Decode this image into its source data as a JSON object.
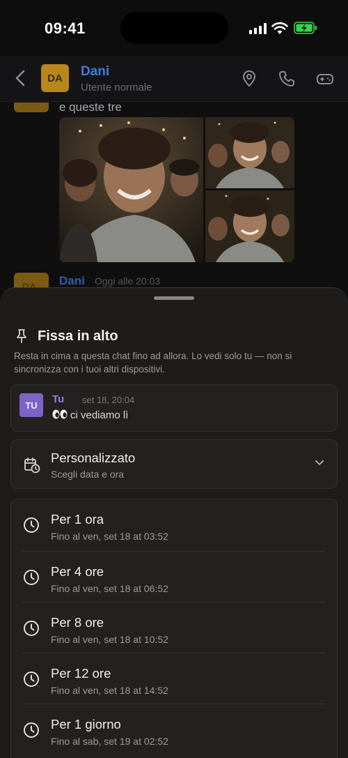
{
  "status_bar": {
    "time": "09:41"
  },
  "chat_header": {
    "avatar_initials": "DA",
    "contact_name": "Dani",
    "contact_subtitle": "Utente normale",
    "icons": [
      "back-arrow-icon",
      "location-pin-icon",
      "phone-icon",
      "gamepad-icon"
    ]
  },
  "chat": {
    "message_text": "e queste tre",
    "next_author_initials": "DA",
    "next_author_name": "Dani",
    "next_author_time": "Oggi alle 20:03"
  },
  "sheet": {
    "title": "Fissa in alto",
    "description": "Resta in cima a questa chat fino ad allora. Lo vedi solo tu — non si sincronizza con i tuoi altri dispositivi.",
    "pinned_message": {
      "avatar_initials": "TU",
      "author": "Tu",
      "time": "set 18, 20:04",
      "text": "ci vediamo lì"
    },
    "custom": {
      "title": "Personalizzato",
      "subtitle": "Scegli data e ora"
    },
    "options": [
      {
        "title": "Per 1 ora",
        "subtitle": "Fino al ven, set 18 at 03:52"
      },
      {
        "title": "Per 4 ore",
        "subtitle": "Fino al ven, set 18 at 06:52"
      },
      {
        "title": "Per 8 ore",
        "subtitle": "Fino al ven, set 18 at 10:52"
      },
      {
        "title": "Per 12 ore",
        "subtitle": "Fino al ven, set 18 at 14:52"
      },
      {
        "title": "Per 1 giorno",
        "subtitle": "Fino al sab, set 19 at 02:52"
      }
    ]
  },
  "colors": {
    "accent_blue": "#3d7ee0",
    "avatar_gold": "#b8871c",
    "avatar_purple": "#7b64c4",
    "sheet_bg": "#1e1c1b"
  }
}
